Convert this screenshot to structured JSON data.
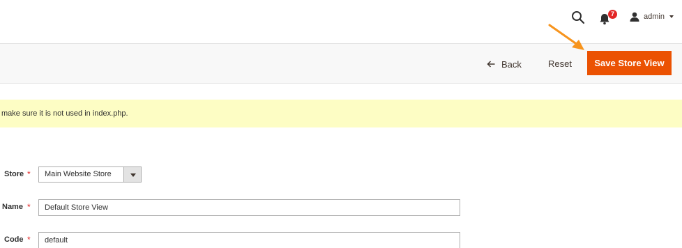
{
  "header": {
    "notifications_count": "7",
    "user_name": "admin"
  },
  "actions": {
    "back_label": "Back",
    "reset_label": "Reset",
    "save_label": "Save Store View"
  },
  "message": {
    "text": "make sure it is not used in index.php."
  },
  "form": {
    "store": {
      "label": "Store",
      "value": "Main Website Store"
    },
    "name": {
      "label": "Name",
      "value": "Default Store View"
    },
    "code": {
      "label": "Code",
      "value": "default"
    }
  },
  "colors": {
    "primary_button": "#eb5202",
    "badge": "#e22626",
    "message_bg": "#fdfdc4",
    "annotation_arrow": "#f7941d"
  },
  "icons": {
    "search": "search-icon",
    "notifications": "bell-icon",
    "user": "user-icon",
    "back": "arrow-left-icon"
  }
}
